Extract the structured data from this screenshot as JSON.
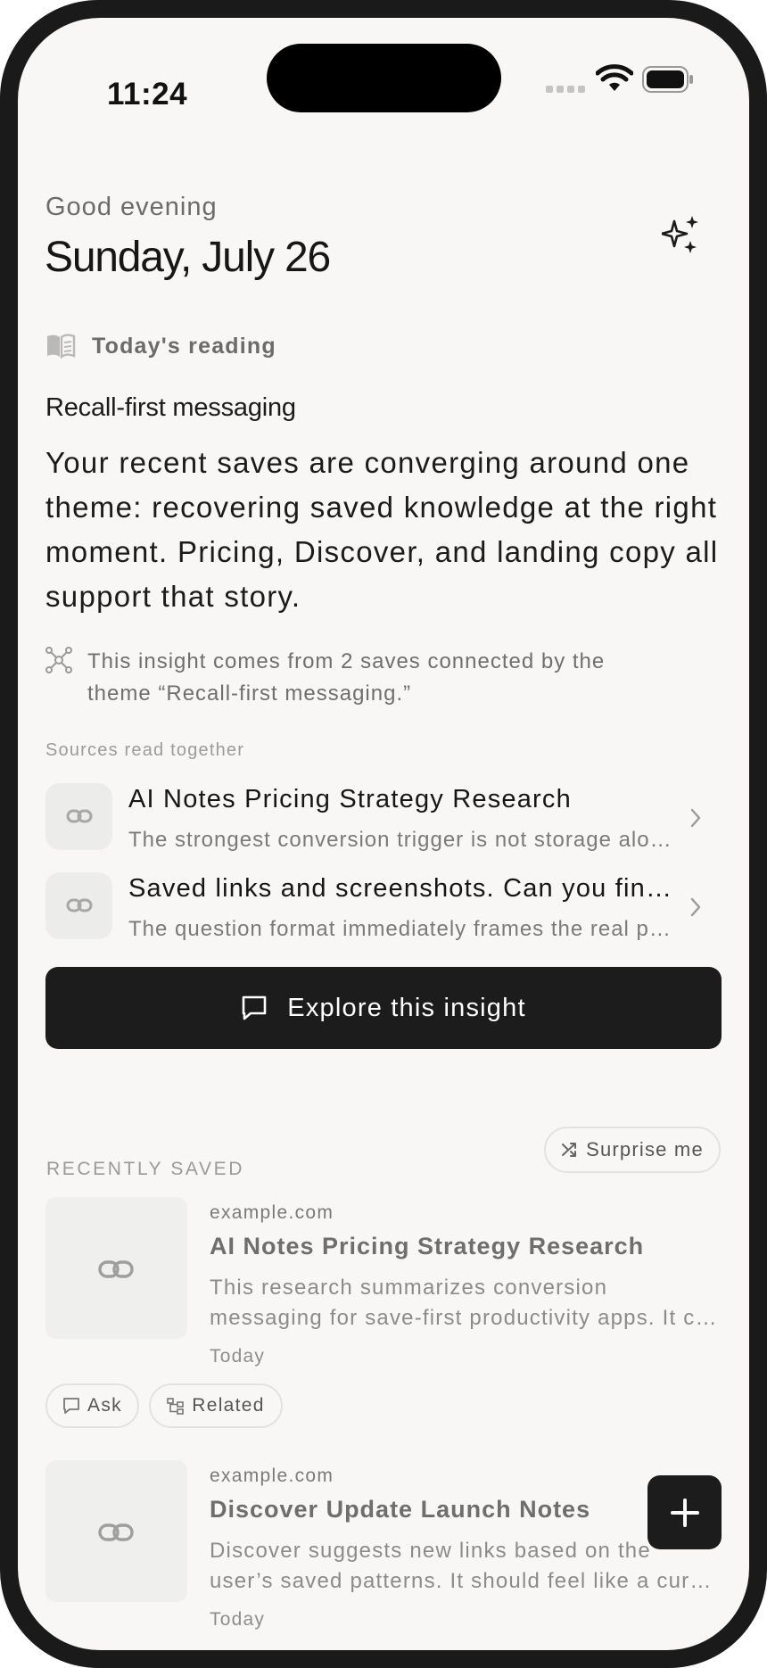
{
  "status_bar": {
    "time": "11:24"
  },
  "header": {
    "greeting": "Good evening",
    "date": "Sunday, July 26",
    "sparkle_icon": "sparkles-icon"
  },
  "todays_reading": {
    "label": "Today's reading",
    "icon": "open-book-icon",
    "title": "Recall-first messaging",
    "body": "Your recent saves are converging around one theme: recovering saved knowledge at the right moment. Pricing, Discover, and landing copy all support that story.",
    "origin_line1": "This insight comes from 2 saves connected by the",
    "origin_line2": "theme “Recall-first messaging.”",
    "sources_label": "Sources read together",
    "sources": [
      {
        "title": "AI Notes Pricing Strategy Research",
        "snippet": "The strongest conversion trigger is not storage alone, it is recall."
      },
      {
        "title": "Saved links and screenshots. Can you find them when you need them?",
        "snippet": "The question format immediately frames the real problem users face."
      }
    ],
    "explore_label": "Explore this insight"
  },
  "recently_saved": {
    "label": "RECENTLY SAVED",
    "surprise_label": "Surprise me",
    "items": [
      {
        "domain": "example.com",
        "title": "AI Notes Pricing Strategy Research",
        "desc_line1": "This research summarizes conversion",
        "desc_line2": "messaging for save-first productivity apps. It compares plans.",
        "date": "Today"
      },
      {
        "domain": "example.com",
        "title": "Discover Update Launch Notes",
        "desc_line1": "Discover suggests new links based on the",
        "desc_line2": "user’s saved patterns. It should feel like a curated feed.",
        "date": "Today"
      }
    ],
    "chip_ask": "Ask",
    "chip_related": "Related"
  },
  "colors": {
    "accent": "#1c1c1c",
    "background": "#f8f7f5",
    "muted_text": "#6b6b6b"
  }
}
